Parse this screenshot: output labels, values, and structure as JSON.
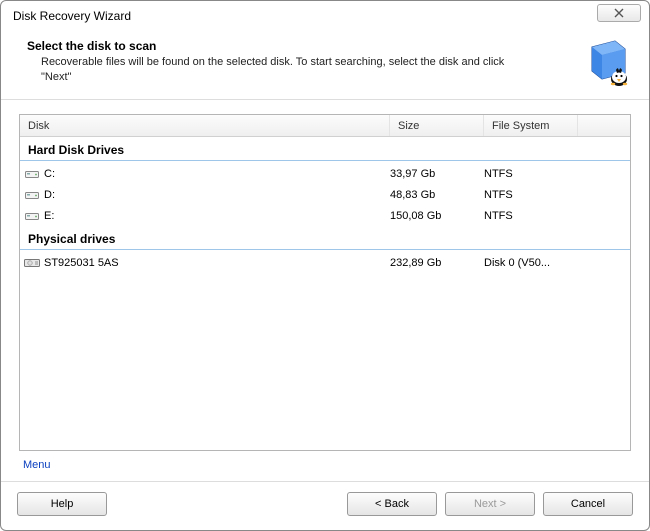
{
  "window": {
    "title": "Disk Recovery Wizard"
  },
  "header": {
    "title": "Select the disk to scan",
    "description": "Recoverable files will be found on the selected disk. To start searching, select the disk and click \"Next\""
  },
  "columns": {
    "disk": "Disk",
    "size": "Size",
    "fs": "File System"
  },
  "groups": [
    {
      "label": "Hard Disk Drives",
      "items": [
        {
          "name": "C:",
          "size": "33,97 Gb",
          "fs": "NTFS"
        },
        {
          "name": "D:",
          "size": "48,83 Gb",
          "fs": "NTFS"
        },
        {
          "name": "E:",
          "size": "150,08 Gb",
          "fs": "NTFS"
        }
      ]
    },
    {
      "label": "Physical drives",
      "items": [
        {
          "name": "ST925031 5AS",
          "size": "232,89 Gb",
          "fs": "Disk 0 (V50..."
        }
      ]
    }
  ],
  "menu": {
    "label": "Menu"
  },
  "buttons": {
    "help": "Help",
    "back": "< Back",
    "next": "Next >",
    "cancel": "Cancel"
  }
}
